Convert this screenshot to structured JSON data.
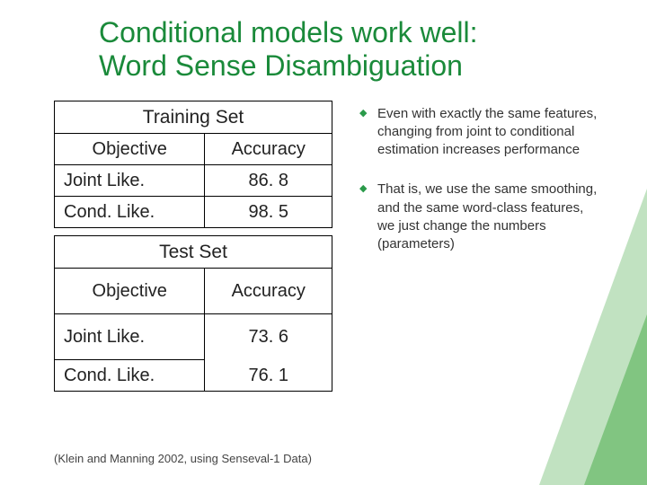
{
  "title_line1": "Conditional models work well:",
  "title_line2": "Word Sense Disambiguation",
  "training": {
    "set_label": "Training Set",
    "col_objective": "Objective",
    "col_accuracy": "Accuracy",
    "rows": [
      {
        "objective": "Joint Like.",
        "accuracy": "86. 8"
      },
      {
        "objective": "Cond. Like.",
        "accuracy": "98. 5"
      }
    ]
  },
  "test": {
    "set_label": "Test Set",
    "col_objective": "Objective",
    "col_accuracy": "Accuracy",
    "rows": [
      {
        "objective": "Joint Like.",
        "accuracy": "73. 6"
      },
      {
        "objective": "Cond. Like.",
        "accuracy": "76. 1"
      }
    ]
  },
  "bullets": [
    "Even with exactly the same features, changing from joint to conditional estimation increases performance",
    "That is, we use the same smoothing, and the same word-class features, we just change the numbers (parameters)"
  ],
  "footnote": "(Klein and Manning 2002, using Senseval-1 Data)",
  "chart_data": [
    {
      "type": "table",
      "title": "Training Set",
      "columns": [
        "Objective",
        "Accuracy"
      ],
      "rows": [
        [
          "Joint Like.",
          86.8
        ],
        [
          "Cond. Like.",
          98.5
        ]
      ]
    },
    {
      "type": "table",
      "title": "Test Set",
      "columns": [
        "Objective",
        "Accuracy"
      ],
      "rows": [
        [
          "Joint Like.",
          73.6
        ],
        [
          "Cond. Like.",
          76.1
        ]
      ]
    }
  ]
}
